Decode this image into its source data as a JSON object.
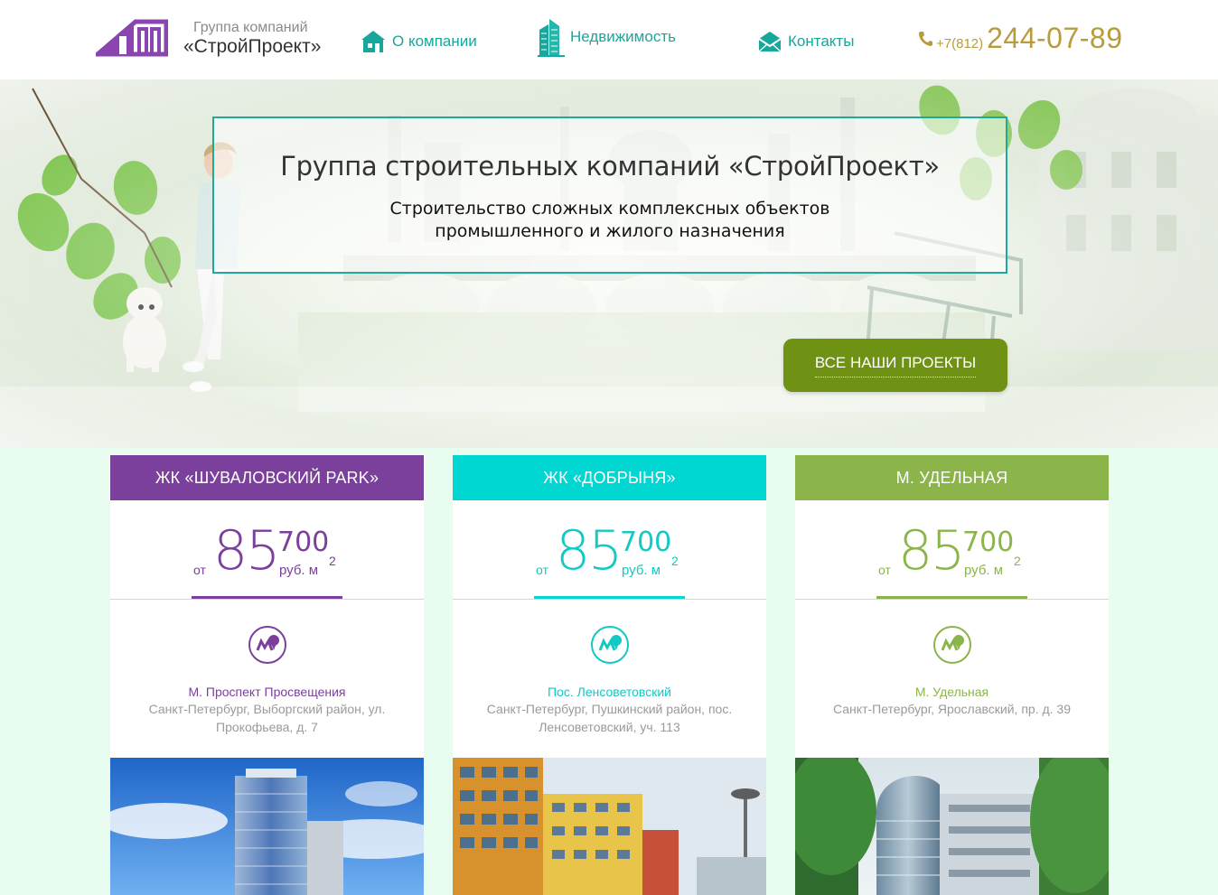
{
  "header": {
    "logo_sub": "Группа компаний",
    "logo_title": "«СтройПроект»",
    "nav": [
      {
        "label": "О компании",
        "icon": "house-icon"
      },
      {
        "label": "Недвижимость",
        "icon": "skyscraper-icon"
      },
      {
        "label": "Контакты",
        "icon": "envelope-icon"
      }
    ],
    "phone_prefix": "+7(812)",
    "phone_number": "244-07-89",
    "phone_icon": "phone-icon"
  },
  "hero": {
    "title": "Группа строительных компаний «СтройПроект»",
    "line1": "Строительство сложных комплексных объектов",
    "line2": "промышленного и жилого назначения",
    "cta_label": "ВСЕ НАШИ ПРОЕКТЫ"
  },
  "projects": [
    {
      "title": "ЖК «ШУВАЛОВСКИЙ PARK»",
      "color": "#7b3f9c",
      "price_from": "от",
      "price_big": "85",
      "price_small": "700",
      "price_unit": "руб. м",
      "price_sup": "2",
      "metro": "М. Проспект Просвещения",
      "address": "Санкт-Петербург, Выборгский район, ул. Прокофьева, д. 7"
    },
    {
      "title": "ЖК «ДОБРЫНЯ»",
      "color": "#00d6d2",
      "price_from": "от",
      "price_big": "85",
      "price_small": "700",
      "price_unit": "руб. м",
      "price_sup": "2",
      "metro": "Пос. Ленсоветовский",
      "address": "Санкт-Петербург, Пушкинский район, пос. Ленсоветовский, уч. 113"
    },
    {
      "title": "М. УДЕЛЬНАЯ",
      "color": "#8bb54a",
      "price_from": "от",
      "price_big": "85",
      "price_small": "700",
      "price_unit": "руб. м",
      "price_sup": "2",
      "metro": "М. Удельная",
      "address": "Санкт-Петербург, Ярославский, пр. д. 39"
    }
  ],
  "colors": {
    "nav": "#18a79c",
    "phone": "#b99b3c",
    "cta": "#6f9214",
    "section_bg": "#e8fdf0"
  }
}
